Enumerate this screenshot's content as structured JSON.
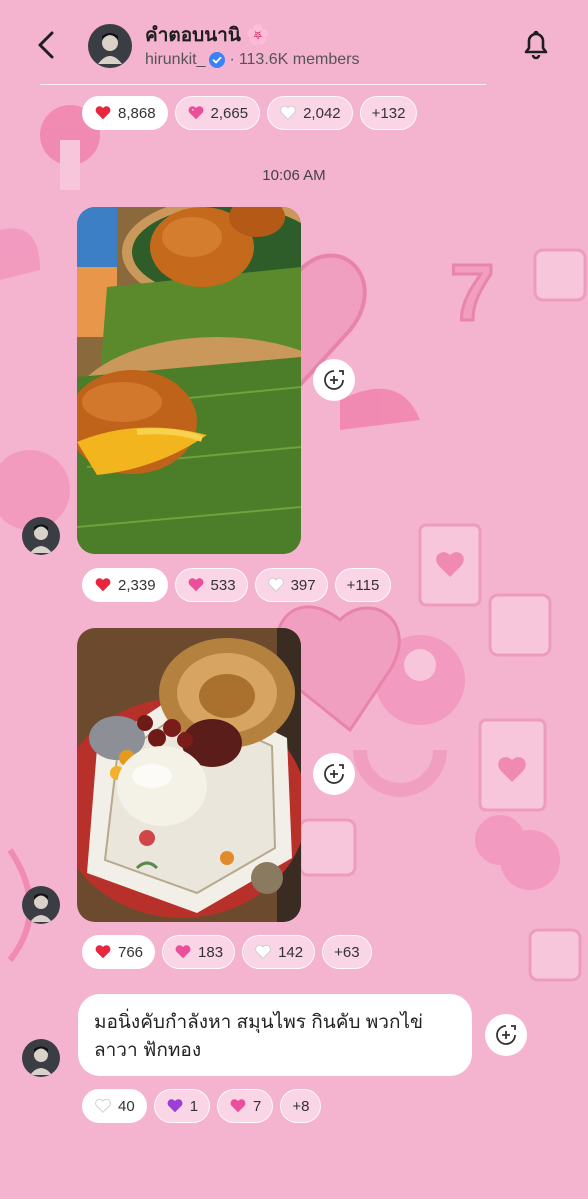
{
  "header": {
    "title": "คำตอบนานิ",
    "title_emoji": "🌸",
    "username": "hirunkit_",
    "separator": "·",
    "members": "113.6K members"
  },
  "colors": {
    "background": "#f4b3cf",
    "verified": "#3b82f6",
    "chip_bg": "#ffffff"
  },
  "top_reactions": [
    {
      "icon": "red-heart-icon",
      "count": "8,868"
    },
    {
      "icon": "pink-heart-icon",
      "count": "2,665"
    },
    {
      "icon": "white-heart-icon",
      "count": "2,042"
    },
    {
      "icon": "",
      "count": "+132"
    }
  ],
  "timestamp": "10:06 AM",
  "photo1": {
    "alt": "Golden custard-filled buns on banana leaves"
  },
  "photo1_reactions": [
    {
      "icon": "red-heart-icon",
      "count": "2,339"
    },
    {
      "icon": "pink-heart-icon",
      "count": "533"
    },
    {
      "icon": "white-heart-icon",
      "count": "397"
    },
    {
      "icon": "",
      "count": "+115"
    }
  ],
  "photo2": {
    "alt": "Ice cream dessert with red beans in a wafer cup"
  },
  "photo2_reactions": [
    {
      "icon": "red-heart-icon",
      "count": "766"
    },
    {
      "icon": "pink-heart-icon",
      "count": "183"
    },
    {
      "icon": "white-heart-icon",
      "count": "142"
    },
    {
      "icon": "",
      "count": "+63"
    }
  ],
  "message": {
    "line1": "มอนิ่งคับกำลังหา สมุนไพร กินคับ พวกไข่",
    "line2": "ลาวา ฟักทอง"
  },
  "message_reactions": [
    {
      "icon": "white-heart-icon",
      "count": "40"
    },
    {
      "icon": "purple-heart-icon",
      "count": "1"
    },
    {
      "icon": "pink-heart-icon",
      "count": "7"
    },
    {
      "icon": "",
      "count": "+8"
    }
  ]
}
